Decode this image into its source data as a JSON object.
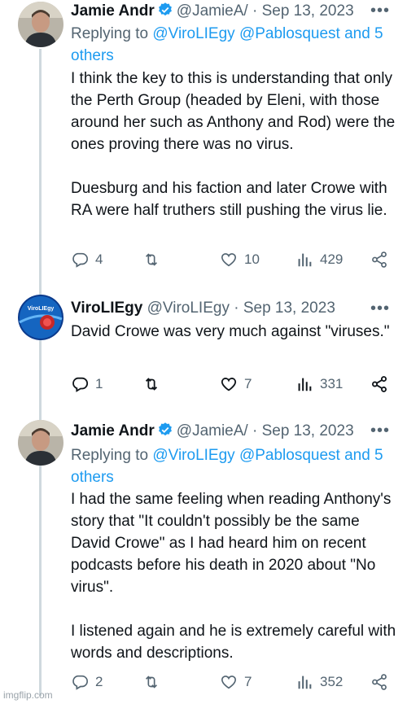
{
  "tweets": [
    {
      "name": "Jamie Andr",
      "handle": "@JamieA/",
      "date": "· Sep 13, 2023",
      "replying_prefix": "Replying to ",
      "replying_mentions": "@ViroLIEgy @Pablosquest and 5",
      "replying_more": "others",
      "body": "I think the key to this is understanding that only the Perth Group (headed by Eleni, with those around her such as Anthony and Rod) were the ones proving there was no virus.\n\nDuesburg and his faction and later Crowe with RA were half truthers still pushing the virus lie.",
      "replies": "4",
      "retweets": "",
      "likes": "10",
      "views": "429"
    },
    {
      "name": "ViroLIEgy",
      "handle": "@ViroLIEgy",
      "date": "· Sep 13, 2023",
      "body": "David Crowe was very much against \"viruses.\"",
      "replies": "1",
      "retweets": "",
      "likes": "7",
      "views": "331",
      "avatar_label": "ViroLIEgy"
    },
    {
      "name": "Jamie Andr",
      "handle": "@JamieA/",
      "date": "· Sep 13, 2023",
      "replying_prefix": "Replying to ",
      "replying_mentions": "@ViroLIEgy @Pablosquest and 5",
      "replying_more": "others",
      "body": "I had the same feeling when reading Anthony's story that \"It couldn't possibly be the same David Crowe\" as I had heard him on recent podcasts before his death in 2020 about \"No virus\".\n\nI listened again and he is extremely careful with words and descriptions.",
      "replies": "2",
      "retweets": "",
      "likes": "7",
      "views": "352"
    }
  ],
  "more_glyph": "•••",
  "watermark": "imgflip.com",
  "colors": {
    "text": "#0f1419",
    "secondary": "#536471",
    "link": "#1d9bf0",
    "thread": "#cfd9de"
  },
  "icons": [
    "reply-icon",
    "retweet-icon",
    "like-icon",
    "views-icon",
    "share-icon",
    "verified-icon",
    "more-icon"
  ]
}
